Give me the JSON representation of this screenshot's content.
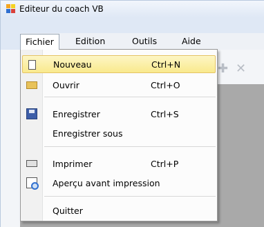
{
  "window": {
    "title": "Editeur du coach VB"
  },
  "menubar": {
    "items": [
      {
        "label": "Fichier"
      },
      {
        "label": "Edition"
      },
      {
        "label": "Outils"
      },
      {
        "label": "Aide"
      }
    ]
  },
  "file_menu": {
    "items": [
      {
        "label": "Nouveau",
        "shortcut": "Ctrl+N",
        "icon": "new-document-icon",
        "highlighted": true
      },
      {
        "label": "Ouvrir",
        "shortcut": "Ctrl+O",
        "icon": "open-folder-icon"
      },
      {
        "label": "Enregistrer",
        "shortcut": "Ctrl+S",
        "icon": "save-disk-icon"
      },
      {
        "label": "Enregistrer sous",
        "shortcut": ""
      },
      {
        "label": "Imprimer",
        "shortcut": "Ctrl+P",
        "icon": "printer-icon"
      },
      {
        "label": "Aperçu avant impression",
        "shortcut": "",
        "icon": "print-preview-icon"
      },
      {
        "label": "Quitter",
        "shortcut": ""
      }
    ]
  },
  "toolbar": {
    "icons": [
      "plus-icon",
      "close-icon"
    ]
  },
  "colors": {
    "highlight": "#f9e98d",
    "workspace": "#a9a9a9"
  }
}
